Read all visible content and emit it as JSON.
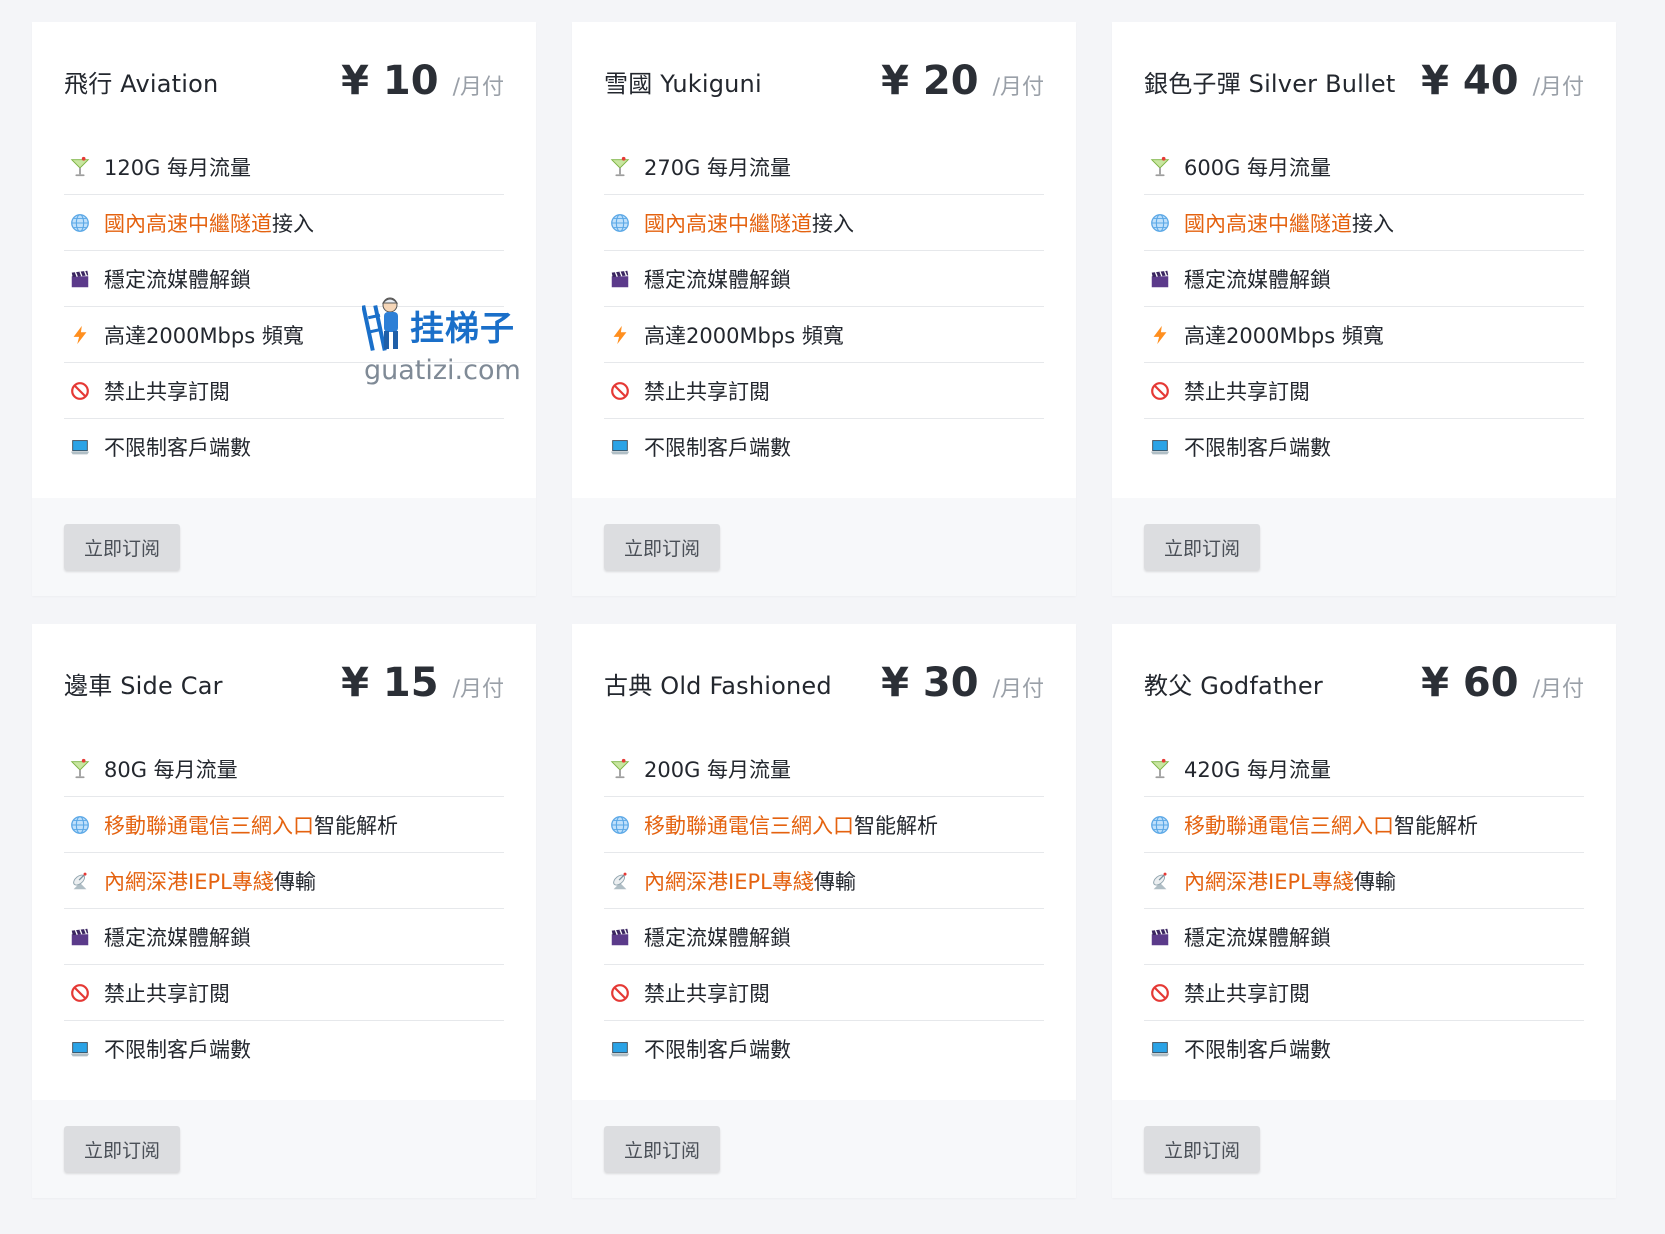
{
  "plans": [
    {
      "name": "飛行 Aviation",
      "price": "¥ 10",
      "unit": "/月付",
      "features": [
        {
          "icon": "cocktail-icon",
          "segments": [
            {
              "text": "120G 每月流量",
              "hl": false
            }
          ]
        },
        {
          "icon": "globe-icon",
          "segments": [
            {
              "text": "國內高速中繼隧道",
              "hl": true
            },
            {
              "text": "接入",
              "hl": false
            }
          ]
        },
        {
          "icon": "clapperboard-icon",
          "segments": [
            {
              "text": "穩定流媒體解鎖",
              "hl": false
            }
          ]
        },
        {
          "icon": "lightning-icon",
          "segments": [
            {
              "text": "高達2000Mbps 頻寬",
              "hl": false
            }
          ]
        },
        {
          "icon": "prohibited-icon",
          "segments": [
            {
              "text": "禁止共享訂閱",
              "hl": false
            }
          ]
        },
        {
          "icon": "laptop-icon",
          "segments": [
            {
              "text": "不限制客戶端數",
              "hl": false
            }
          ]
        }
      ],
      "button": "立即订阅"
    },
    {
      "name": "雪國 Yukiguni",
      "price": "¥ 20",
      "unit": "/月付",
      "features": [
        {
          "icon": "cocktail-icon",
          "segments": [
            {
              "text": "270G 每月流量",
              "hl": false
            }
          ]
        },
        {
          "icon": "globe-icon",
          "segments": [
            {
              "text": "國內高速中繼隧道",
              "hl": true
            },
            {
              "text": "接入",
              "hl": false
            }
          ]
        },
        {
          "icon": "clapperboard-icon",
          "segments": [
            {
              "text": "穩定流媒體解鎖",
              "hl": false
            }
          ]
        },
        {
          "icon": "lightning-icon",
          "segments": [
            {
              "text": "高達2000Mbps 頻寬",
              "hl": false
            }
          ]
        },
        {
          "icon": "prohibited-icon",
          "segments": [
            {
              "text": "禁止共享訂閱",
              "hl": false
            }
          ]
        },
        {
          "icon": "laptop-icon",
          "segments": [
            {
              "text": "不限制客戶端數",
              "hl": false
            }
          ]
        }
      ],
      "button": "立即订阅"
    },
    {
      "name": "銀色子彈 Silver Bullet",
      "price": "¥ 40",
      "unit": "/月付",
      "features": [
        {
          "icon": "cocktail-icon",
          "segments": [
            {
              "text": "600G 每月流量",
              "hl": false
            }
          ]
        },
        {
          "icon": "globe-icon",
          "segments": [
            {
              "text": "國內高速中繼隧道",
              "hl": true
            },
            {
              "text": "接入",
              "hl": false
            }
          ]
        },
        {
          "icon": "clapperboard-icon",
          "segments": [
            {
              "text": "穩定流媒體解鎖",
              "hl": false
            }
          ]
        },
        {
          "icon": "lightning-icon",
          "segments": [
            {
              "text": "高達2000Mbps 頻寬",
              "hl": false
            }
          ]
        },
        {
          "icon": "prohibited-icon",
          "segments": [
            {
              "text": "禁止共享訂閱",
              "hl": false
            }
          ]
        },
        {
          "icon": "laptop-icon",
          "segments": [
            {
              "text": "不限制客戶端數",
              "hl": false
            }
          ]
        }
      ],
      "button": "立即订阅"
    },
    {
      "name": "邊車 Side Car",
      "price": "¥ 15",
      "unit": "/月付",
      "features": [
        {
          "icon": "cocktail-icon",
          "segments": [
            {
              "text": "80G 每月流量",
              "hl": false
            }
          ]
        },
        {
          "icon": "globe-icon",
          "segments": [
            {
              "text": "移動聯通電信三網入口",
              "hl": true
            },
            {
              "text": "智能解析",
              "hl": false
            }
          ]
        },
        {
          "icon": "satellite-icon",
          "segments": [
            {
              "text": "內網深港IEPL專綫",
              "hl": true
            },
            {
              "text": "傳輸",
              "hl": false
            }
          ]
        },
        {
          "icon": "clapperboard-icon",
          "segments": [
            {
              "text": "穩定流媒體解鎖",
              "hl": false
            }
          ]
        },
        {
          "icon": "prohibited-icon",
          "segments": [
            {
              "text": "禁止共享訂閱",
              "hl": false
            }
          ]
        },
        {
          "icon": "laptop-icon",
          "segments": [
            {
              "text": "不限制客戶端數",
              "hl": false
            }
          ]
        }
      ],
      "button": "立即订阅"
    },
    {
      "name": "古典 Old Fashioned",
      "price": "¥ 30",
      "unit": "/月付",
      "features": [
        {
          "icon": "cocktail-icon",
          "segments": [
            {
              "text": "200G 每月流量",
              "hl": false
            }
          ]
        },
        {
          "icon": "globe-icon",
          "segments": [
            {
              "text": "移動聯通電信三網入口",
              "hl": true
            },
            {
              "text": "智能解析",
              "hl": false
            }
          ]
        },
        {
          "icon": "satellite-icon",
          "segments": [
            {
              "text": "內網深港IEPL專綫",
              "hl": true
            },
            {
              "text": "傳輸",
              "hl": false
            }
          ]
        },
        {
          "icon": "clapperboard-icon",
          "segments": [
            {
              "text": "穩定流媒體解鎖",
              "hl": false
            }
          ]
        },
        {
          "icon": "prohibited-icon",
          "segments": [
            {
              "text": "禁止共享訂閱",
              "hl": false
            }
          ]
        },
        {
          "icon": "laptop-icon",
          "segments": [
            {
              "text": "不限制客戶端數",
              "hl": false
            }
          ]
        }
      ],
      "button": "立即订阅"
    },
    {
      "name": "教父 Godfather",
      "price": "¥ 60",
      "unit": "/月付",
      "features": [
        {
          "icon": "cocktail-icon",
          "segments": [
            {
              "text": "420G 每月流量",
              "hl": false
            }
          ]
        },
        {
          "icon": "globe-icon",
          "segments": [
            {
              "text": "移動聯通電信三網入口",
              "hl": true
            },
            {
              "text": "智能解析",
              "hl": false
            }
          ]
        },
        {
          "icon": "satellite-icon",
          "segments": [
            {
              "text": "內網深港IEPL專綫",
              "hl": true
            },
            {
              "text": "傳輸",
              "hl": false
            }
          ]
        },
        {
          "icon": "clapperboard-icon",
          "segments": [
            {
              "text": "穩定流媒體解鎖",
              "hl": false
            }
          ]
        },
        {
          "icon": "prohibited-icon",
          "segments": [
            {
              "text": "禁止共享訂閱",
              "hl": false
            }
          ]
        },
        {
          "icon": "laptop-icon",
          "segments": [
            {
              "text": "不限制客戶端數",
              "hl": false
            }
          ]
        }
      ],
      "button": "立即订阅"
    }
  ],
  "watermark": {
    "cn": "挂梯子",
    "en": "guatizi.com"
  },
  "colors": {
    "highlight": "#e4620f",
    "watermark_blue": "#1a6fc9",
    "button_bg": "#dcdde0"
  }
}
